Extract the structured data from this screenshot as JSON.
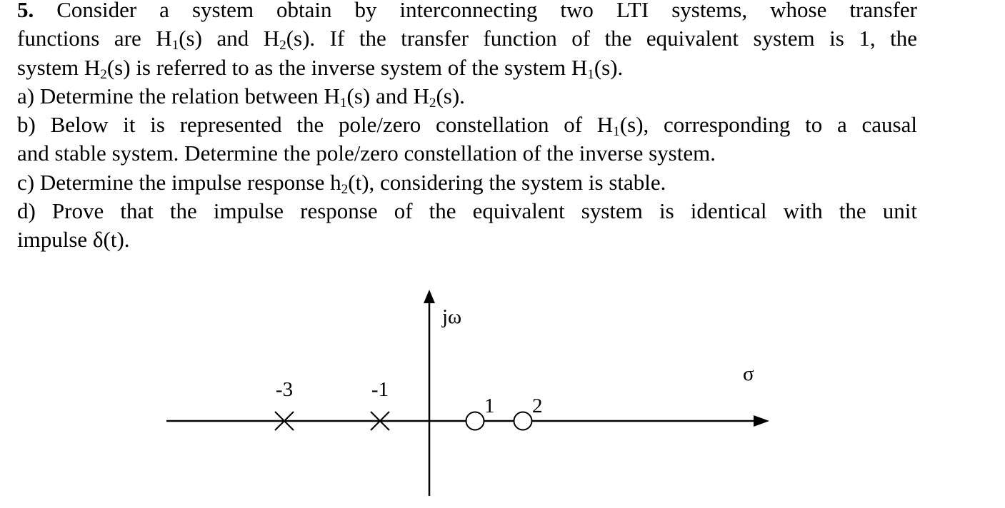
{
  "problem": {
    "number": "5.",
    "intro": [
      {
        "text": " Consider a system obtain by interconnecting two LTI systems, whose transfer"
      },
      {
        "pre": "functions are H",
        "sub1": "1",
        "mid1": "(s) and H",
        "sub2": "2",
        "post": "(s). If the transfer function of the equivalent system is 1, the"
      },
      {
        "pre": "system H",
        "sub1": "2",
        "mid1": "(s) is referred to as the inverse system of the system H",
        "sub2": "1",
        "post": "(s)."
      }
    ],
    "parts": {
      "a": {
        "pre": "a) Determine the relation between H",
        "sub1": "1",
        "mid1": "(s) and H",
        "sub2": "2",
        "post": "(s)."
      },
      "b1": {
        "pre": "b) Below it is represented the pole/zero constellation of H",
        "sub1": "1",
        "post": "(s), corresponding to a causal"
      },
      "b2": {
        "text": "and stable system. Determine the pole/zero constellation of the inverse system."
      },
      "c": {
        "pre": "c) Determine the impulse response h",
        "sub1": "2",
        "post": "(t), considering the system is stable."
      },
      "d1": {
        "text": "d) Prove that the impulse response of the equivalent system is identical with the unit"
      },
      "d2": {
        "text": "impulse δ(t)."
      }
    }
  },
  "diagram": {
    "axis_labels": {
      "vertical": "jω",
      "horizontal": "σ"
    },
    "poles": [
      {
        "value": -3,
        "label": "-3",
        "marker": "x-icon"
      },
      {
        "value": -1,
        "label": "-1",
        "marker": "x-icon"
      }
    ],
    "zeros": [
      {
        "value": 1,
        "label": "1",
        "marker": "circle-icon"
      },
      {
        "value": 2,
        "label": "2",
        "marker": "circle-icon"
      }
    ]
  }
}
